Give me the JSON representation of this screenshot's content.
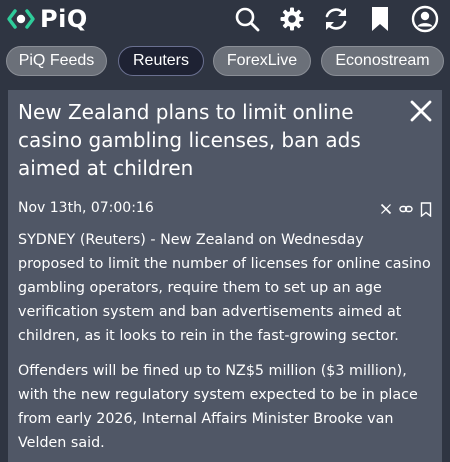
{
  "app": {
    "logo_text": "PiQ",
    "brand_color": "#2ecc9a"
  },
  "header_icons": [
    "search-icon",
    "gear-icon",
    "refresh-icon",
    "bookmark-icon",
    "profile-icon"
  ],
  "tabs": [
    {
      "label": "PiQ Feeds",
      "active": false
    },
    {
      "label": "Reuters",
      "active": true
    },
    {
      "label": "ForexLive",
      "active": false
    },
    {
      "label": "Econostream",
      "active": false
    }
  ],
  "article": {
    "title": "New Zealand plans to limit online casino gambling licenses, ban ads aimed at children",
    "date": "Nov 13th, 07:00:16",
    "paragraphs": [
      "SYDNEY (Reuters) - New Zealand on Wednesday proposed to limit the number of licenses for online casino gambling operators, require them to set up an age verification system and ban advertisements aimed at children, as it looks to rein in the fast-growing sector.",
      "Offenders will be fined up to NZ$5 million ($3 million), with the new regulatory system expected to be in place from early 2026, Internal Affairs Minister Brooke van Velden said."
    ],
    "action_icons": [
      "x-share-icon",
      "link-icon",
      "bookmark-icon"
    ]
  }
}
